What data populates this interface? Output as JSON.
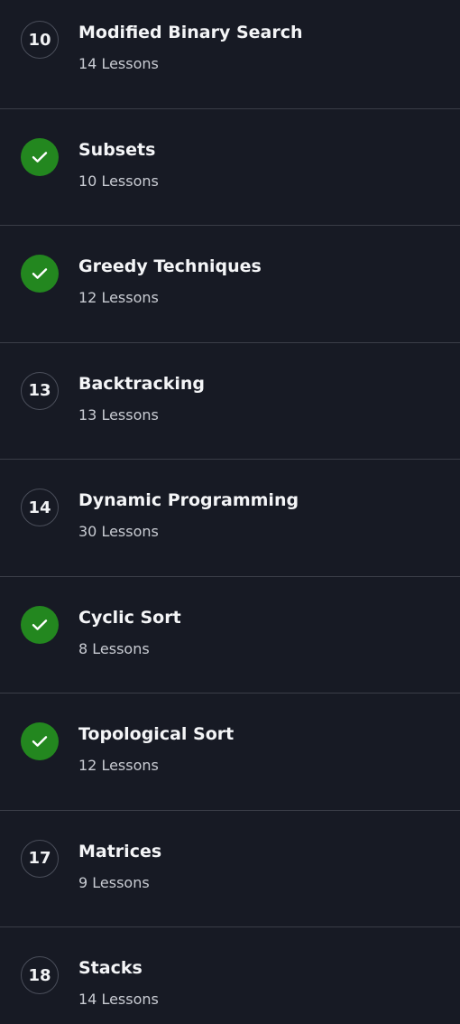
{
  "colors": {
    "background": "#171a24",
    "divider": "#3a3d47",
    "completed": "#23871f",
    "badge_border": "#4a4e5a"
  },
  "modules": [
    {
      "number": "10",
      "completed": false,
      "title": "Modified Binary Search",
      "lessons": "14 Lessons"
    },
    {
      "number": "",
      "completed": true,
      "icon": "check-icon",
      "title": "Subsets",
      "lessons": "10 Lessons"
    },
    {
      "number": "",
      "completed": true,
      "icon": "check-icon",
      "title": "Greedy Techniques",
      "lessons": "12 Lessons"
    },
    {
      "number": "13",
      "completed": false,
      "title": "Backtracking",
      "lessons": "13 Lessons"
    },
    {
      "number": "14",
      "completed": false,
      "title": "Dynamic Programming",
      "lessons": "30 Lessons"
    },
    {
      "number": "",
      "completed": true,
      "icon": "check-icon",
      "title": "Cyclic Sort",
      "lessons": "8 Lessons"
    },
    {
      "number": "",
      "completed": true,
      "icon": "check-icon",
      "title": "Topological Sort",
      "lessons": "12 Lessons"
    },
    {
      "number": "17",
      "completed": false,
      "title": "Matrices",
      "lessons": "9 Lessons"
    },
    {
      "number": "18",
      "completed": false,
      "title": "Stacks",
      "lessons": "14 Lessons"
    }
  ]
}
